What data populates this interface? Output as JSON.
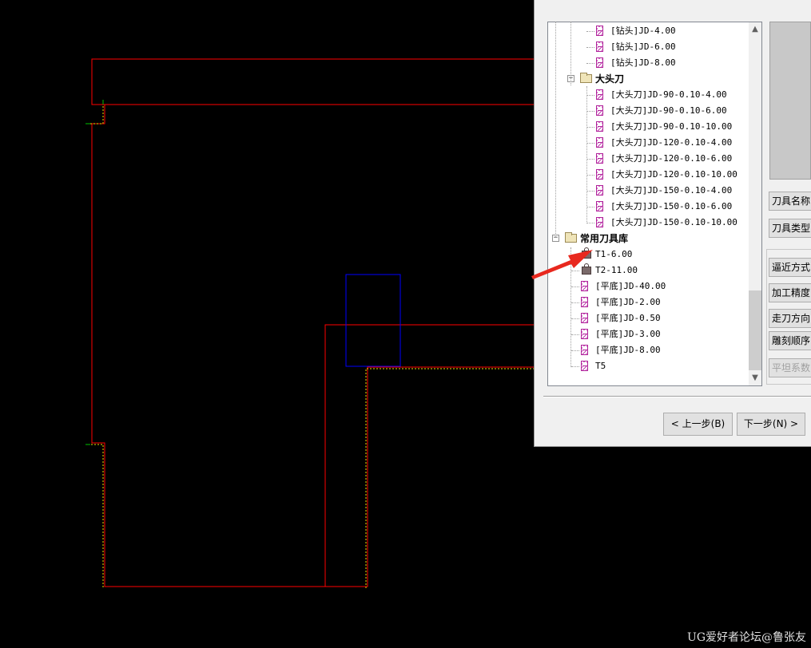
{
  "tree": {
    "items": [
      {
        "type": "tool",
        "label": "[钻头]JD-4.00"
      },
      {
        "type": "tool",
        "label": "[钻头]JD-6.00"
      },
      {
        "type": "tool",
        "label": "[钻头]JD-8.00"
      },
      {
        "type": "folder",
        "label": "大头刀",
        "expander": "−"
      },
      {
        "type": "tool",
        "label": "[大头刀]JD-90-0.10-4.00"
      },
      {
        "type": "tool",
        "label": "[大头刀]JD-90-0.10-6.00"
      },
      {
        "type": "tool",
        "label": "[大头刀]JD-90-0.10-10.00"
      },
      {
        "type": "tool",
        "label": "[大头刀]JD-120-0.10-4.00"
      },
      {
        "type": "tool",
        "label": "[大头刀]JD-120-0.10-6.00"
      },
      {
        "type": "tool",
        "label": "[大头刀]JD-120-0.10-10.00"
      },
      {
        "type": "tool",
        "label": "[大头刀]JD-150-0.10-4.00"
      },
      {
        "type": "tool",
        "label": "[大头刀]JD-150-0.10-6.00"
      },
      {
        "type": "tool",
        "label": "[大头刀]JD-150-0.10-10.00"
      },
      {
        "type": "folder",
        "label": "常用刀具库",
        "expander": "−"
      },
      {
        "type": "locked",
        "label": "T1-6.00"
      },
      {
        "type": "locked",
        "label": "T2-11.00"
      },
      {
        "type": "tool",
        "label": "[平底]JD-40.00"
      },
      {
        "type": "tool",
        "label": "[平底]JD-2.00"
      },
      {
        "type": "tool",
        "label": "[平底]JD-0.50"
      },
      {
        "type": "tool",
        "label": "[平底]JD-3.00"
      },
      {
        "type": "tool",
        "label": "[平底]JD-8.00"
      },
      {
        "type": "tool",
        "label": "T5"
      }
    ]
  },
  "side_buttons": {
    "tool_name": "刀具名称",
    "tool_type": "刀具类型",
    "approach": "逼近方式",
    "precision": "加工精度",
    "direction": "走刀方向",
    "order": "雕刻顺序",
    "flatness": "平坦系数"
  },
  "nav": {
    "prev": "< 上一步(B)",
    "next": "下一步(N) >"
  },
  "scroll": {
    "up": "▲",
    "down": "▼"
  },
  "watermark": "UG爱好者论坛@鲁张友",
  "colors": {
    "cad_bg": "#000000",
    "outline": "#ff0000",
    "selection": "#0000ff",
    "annotation_arrow": "#e8281e"
  }
}
